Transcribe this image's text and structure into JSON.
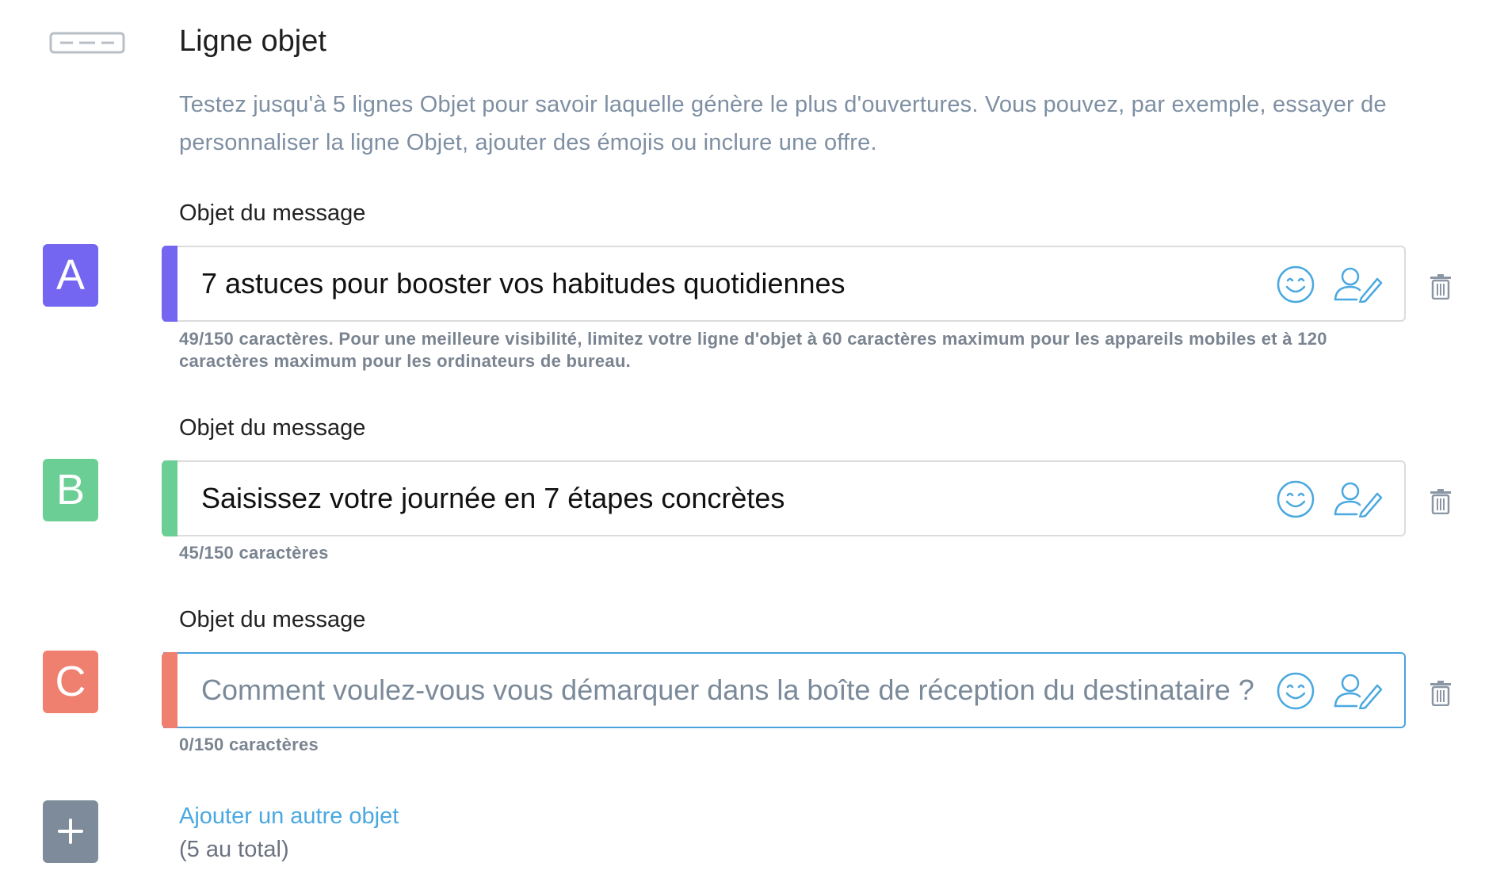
{
  "section": {
    "icon": "subject-line-icon",
    "title": "Ligne objet",
    "description": "Testez jusqu'à 5 lignes Objet pour savoir laquelle génère le plus d'ouvertures. Vous pouvez, par exemple, essayer de personnaliser la ligne Objet, ajouter des émojis ou inclure une offre."
  },
  "subjects": [
    {
      "letter": "A",
      "color": "#7466f0",
      "label": "Objet du message",
      "value": "7 astuces pour booster vos habitudes quotidiennes",
      "placeholder": "",
      "help": "49/150 caractères. Pour une meilleure visibilité, limitez votre ligne d'objet à 60 caractères maximum pour les appareils mobiles et à 120 caractères maximum pour les ordinateurs de bureau."
    },
    {
      "letter": "B",
      "color": "#6bcf95",
      "label": "Objet du message",
      "value": "Saisissez votre journée en 7 étapes concrètes",
      "placeholder": "",
      "help": "45/150 caractères"
    },
    {
      "letter": "C",
      "color": "#ef7f6f",
      "label": "Objet du message",
      "value": "",
      "placeholder": "Comment voulez-vous vous démarquer dans la boîte de réception du destinataire ?",
      "help": "0/150 caractères"
    }
  ],
  "icons": {
    "emoji": "smiley-icon",
    "personalize": "person-edit-icon",
    "delete": "trash-icon",
    "accent_icon_color": "#4aa8e0",
    "trash_color": "#8a96a3"
  },
  "add": {
    "icon": "plus-icon",
    "label": "Ajouter un autre objet",
    "sub": "(5 au total)"
  }
}
